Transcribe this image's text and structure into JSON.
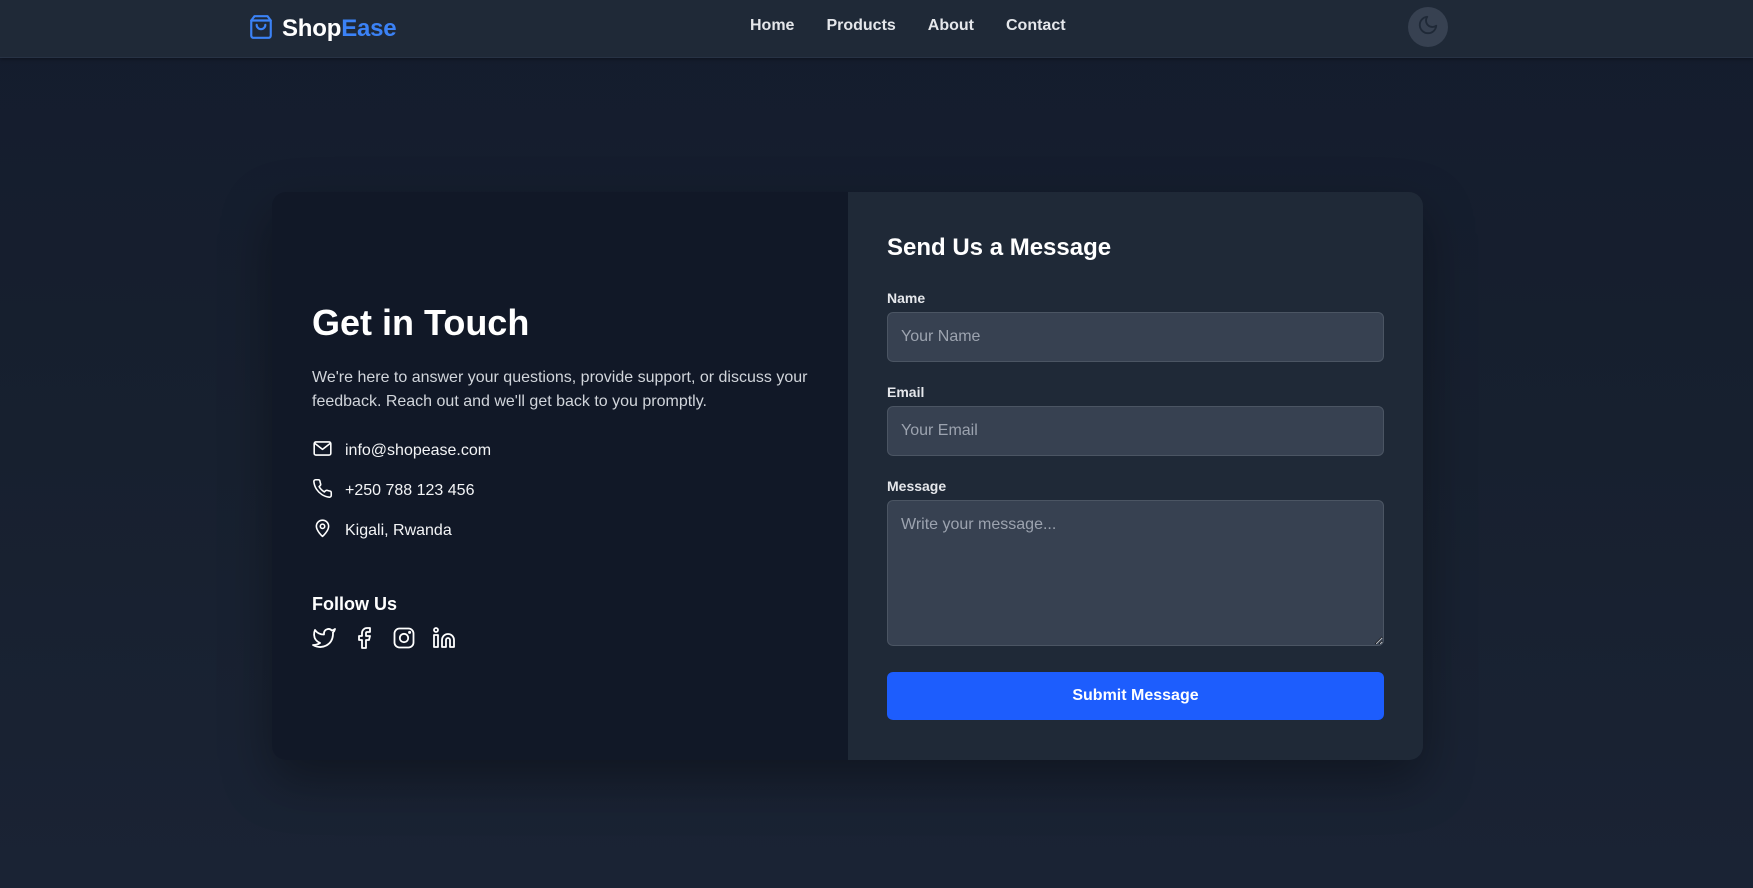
{
  "nav": {
    "brand_part1": "Shop",
    "brand_part2": "Ease",
    "logo_icon": "shopping-bag-icon",
    "links": [
      "Home",
      "Products",
      "About",
      "Contact"
    ],
    "theme_icon": "moon-icon"
  },
  "contact": {
    "title": "Get in Touch",
    "description": "We're here to answer your questions, provide support, or discuss your feedback. Reach out and we'll get back to you promptly.",
    "email": "info@shopease.com",
    "phone": "+250 788 123 456",
    "location": "Kigali, Rwanda",
    "follow_title": "Follow Us",
    "socials": [
      "twitter-icon",
      "facebook-icon",
      "instagram-icon",
      "linkedin-icon"
    ]
  },
  "form": {
    "title": "Send Us a Message",
    "name_label": "Name",
    "name_placeholder": "Your Name",
    "email_label": "Email",
    "email_placeholder": "Your Email",
    "message_label": "Message",
    "message_placeholder": "Write your message...",
    "submit_label": "Submit Message"
  },
  "colors": {
    "accent": "#3b82f6",
    "button": "#1d5dfd",
    "nav_bg": "#1f2937",
    "left_panel": "#111827",
    "right_panel": "#1f2937",
    "input_bg": "#374151"
  }
}
